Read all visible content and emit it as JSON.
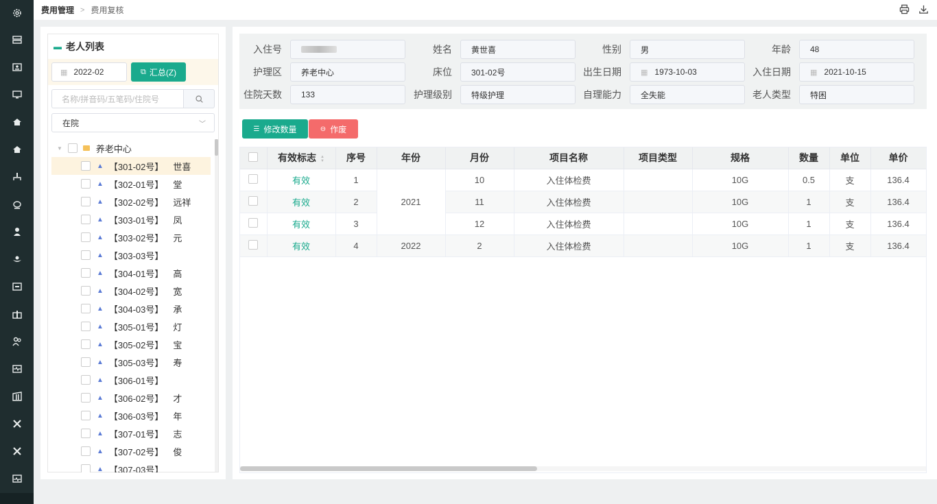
{
  "breadcrumb": {
    "parent": "费用管理",
    "current": "费用复核"
  },
  "toolbar": {
    "print_icon": "printer-icon",
    "download_icon": "download-icon"
  },
  "nav_icons": [
    "gear-icon",
    "server-icon",
    "id-card-icon",
    "monitor-icon",
    "home-icon",
    "home-icon",
    "tree-icon",
    "cup-icon",
    "nurse-icon",
    "hand-icon",
    "box-icon",
    "gift-icon",
    "users-icon",
    "heartbeat-icon",
    "building-icon",
    "tools-icon",
    "tools-icon",
    "pulse-icon"
  ],
  "left": {
    "title": "老人列表",
    "month": "2022-02",
    "summary_button": "汇总(Z)",
    "search_placeholder": "名称/拼音码/五笔码/住院号",
    "status_select": "在院",
    "root": "养老中心",
    "items": [
      "【301-02号】",
      "【302-01号】",
      "【302-02号】",
      "【303-01号】",
      "【303-02号】",
      "【303-03号】",
      "【304-01号】",
      "【304-02号】",
      "【304-03号】",
      "【305-01号】",
      "【305-02号】",
      "【305-03号】",
      "【306-01号】",
      "【306-02号】",
      "【306-03号】",
      "【307-01号】",
      "【307-02号】",
      "【307-03号】"
    ],
    "item_suffixes": [
      "世喜",
      "堂",
      "远祥",
      "凤",
      "元",
      "",
      "高",
      "宽",
      "承",
      "灯",
      "宝",
      "寿",
      "",
      "才",
      "年",
      "志",
      "俊",
      ""
    ]
  },
  "info": {
    "admission_no_label": "入住号",
    "name_label": "姓名",
    "name": "黄世喜",
    "gender_label": "性别",
    "gender": "男",
    "age_label": "年龄",
    "age": "48",
    "care_area_label": "护理区",
    "care_area": "养老中心",
    "bed_label": "床位",
    "bed": "301-02号",
    "birth_label": "出生日期",
    "birth": "1973-10-03",
    "admit_date_label": "入住日期",
    "admit_date": "2021-10-15",
    "stay_days_label": "住院天数",
    "stay_days": "133",
    "care_level_label": "护理级别",
    "care_level": "特级护理",
    "self_care_label": "自理能力",
    "self_care": "全失能",
    "elder_type_label": "老人类型",
    "elder_type": "特困"
  },
  "actions": {
    "edit_qty": "修改数量",
    "void": "作废"
  },
  "table": {
    "headers": [
      "有效标志",
      "序号",
      "年份",
      "月份",
      "项目名称",
      "项目类型",
      "规格",
      "数量",
      "单位",
      "单价"
    ],
    "rows": [
      {
        "valid": "有效",
        "seq": "1",
        "year": "2021",
        "month": "10",
        "name": "入住体检费",
        "type": "",
        "spec": "10G",
        "qty": "0.5",
        "unit": "支",
        "price": "136.4"
      },
      {
        "valid": "有效",
        "seq": "2",
        "year": "2021",
        "month": "11",
        "name": "入住体检费",
        "type": "",
        "spec": "10G",
        "qty": "1",
        "unit": "支",
        "price": "136.4"
      },
      {
        "valid": "有效",
        "seq": "3",
        "year": "2021",
        "month": "12",
        "name": "入住体检费",
        "type": "",
        "spec": "10G",
        "qty": "1",
        "unit": "支",
        "price": "136.4"
      },
      {
        "valid": "有效",
        "seq": "4",
        "year": "2022",
        "month": "2",
        "name": "入住体检费",
        "type": "",
        "spec": "10G",
        "qty": "1",
        "unit": "支",
        "price": "136.4"
      }
    ]
  }
}
